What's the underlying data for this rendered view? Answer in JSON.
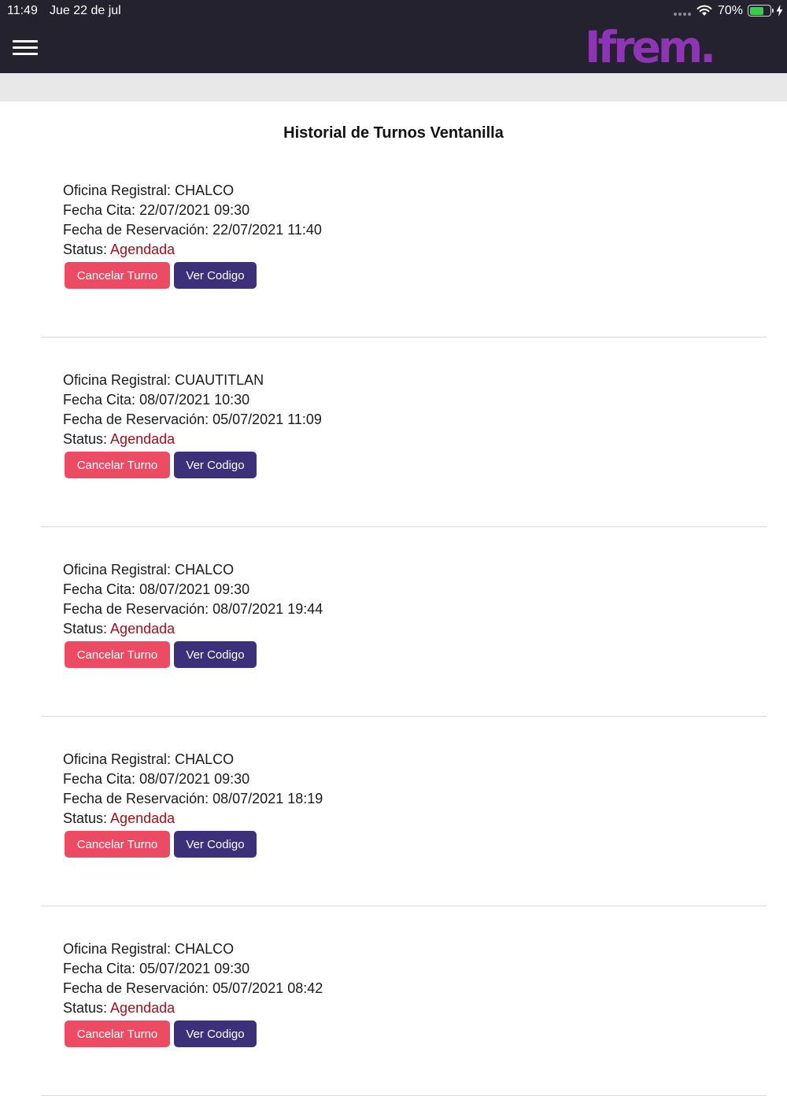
{
  "status_bar": {
    "time": "11:49",
    "date": "Jue 22 de jul",
    "battery": "70%",
    "battery_level": 0.7
  },
  "header": {
    "logo_text": "Ifrem.",
    "brand_color": "#8e35b5",
    "background_color": "#24222f"
  },
  "page": {
    "title": "Historial de Turnos Ventanilla"
  },
  "labels": {
    "oficina": "Oficina Registral:",
    "fecha_cita": "Fecha Cita:",
    "fecha_reservacion": "Fecha de Reservación:",
    "status": "Status:",
    "cancel_button": "Cancelar Turno",
    "code_button": "Ver Codigo"
  },
  "colors": {
    "cancel_button": "#ec4b63",
    "code_button": "#3c307a",
    "status_value": "#a5101a"
  },
  "turnos": [
    {
      "oficina": "CHALCO",
      "fecha_cita": "22/07/2021 09:30",
      "fecha_reservacion": "22/07/2021 11:40",
      "status": "Agendada"
    },
    {
      "oficina": "CUAUTITLAN",
      "fecha_cita": "08/07/2021 10:30",
      "fecha_reservacion": "05/07/2021 11:09",
      "status": "Agendada"
    },
    {
      "oficina": "CHALCO",
      "fecha_cita": "08/07/2021 09:30",
      "fecha_reservacion": "08/07/2021 19:44",
      "status": "Agendada"
    },
    {
      "oficina": "CHALCO",
      "fecha_cita": "08/07/2021 09:30",
      "fecha_reservacion": "08/07/2021 18:19",
      "status": "Agendada"
    },
    {
      "oficina": "CHALCO",
      "fecha_cita": "05/07/2021 09:30",
      "fecha_reservacion": "05/07/2021 08:42",
      "status": "Agendada"
    }
  ]
}
